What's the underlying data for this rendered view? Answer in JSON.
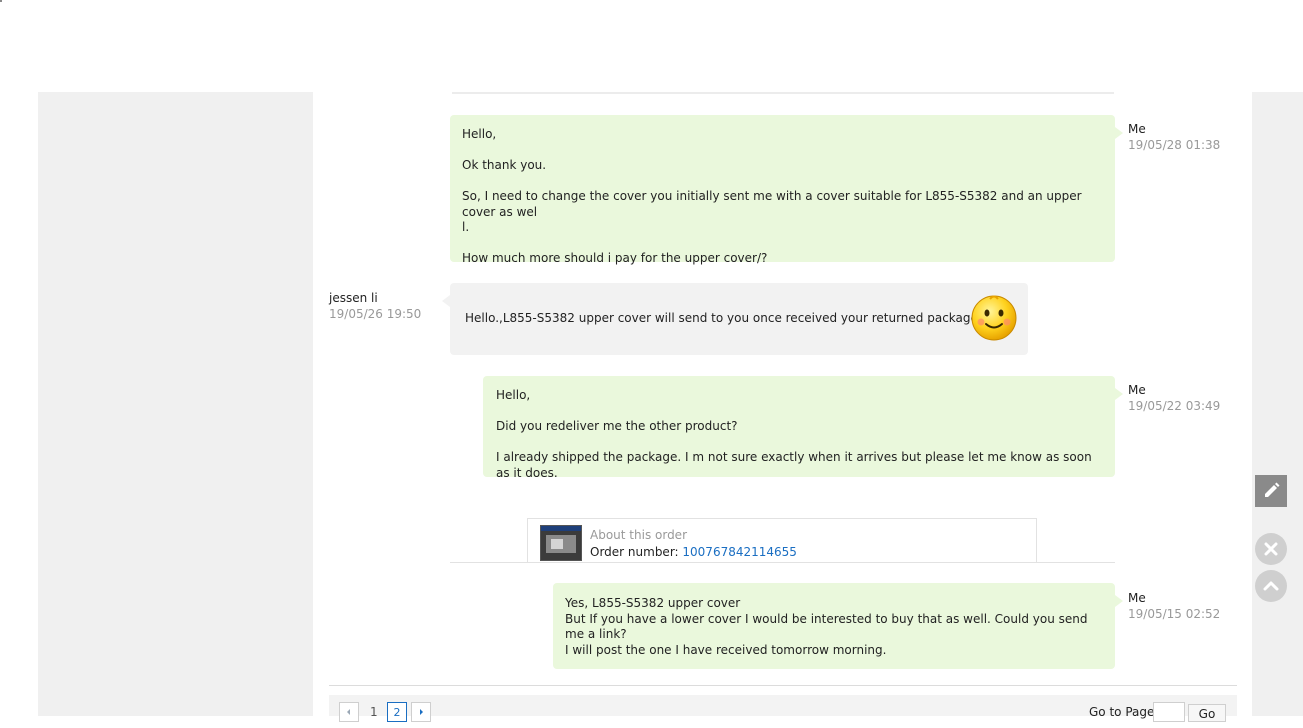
{
  "colors": {
    "me_bubble": "#eaf8dc",
    "other_bubble": "#f2f2f2",
    "link": "#1a6ec2",
    "timestamp": "#999999"
  },
  "messages": [
    {
      "sender": "Me",
      "time": "19/05/28 01:38",
      "lines": [
        "Hello,",
        "Ok thank you.",
        "So, I need to change the cover you initially sent me with a cover suitable for L855-S5382 and an upper cover as wel",
        "l.",
        "How much more should i pay for the upper cover/?"
      ]
    },
    {
      "sender": "jessen li",
      "time": "19/05/26 19:50",
      "lines": [
        "Hello.,L855-S5382 upper cover will send to you once received  your returned package okey"
      ],
      "icon": "smiley-emoticon-icon"
    },
    {
      "sender": "Me",
      "time": "19/05/22 03:49",
      "lines": [
        "Hello,",
        "Did you redeliver me the other product?",
        "I already shipped the package. I m not sure exactly when it arrives but please let me know as soon as it does."
      ]
    },
    {
      "sender": "Me",
      "time": "19/05/15 02:52",
      "lines": [
        "Yes,  L855-S5382 upper cover",
        "But If you have a lower cover I would be interested to buy that as well. Could you send me a link?",
        "I will post the one I have received tomorrow morning."
      ]
    }
  ],
  "order_card": {
    "label": "About this order",
    "number_label": "Order number: ",
    "number": "100767842114655",
    "icon": "product-thumbnail-image"
  },
  "pagination": {
    "prev_icon": "chevron-left-icon",
    "next_icon": "chevron-right-icon",
    "pages": [
      "1",
      "2"
    ],
    "current_page": "2",
    "goto_label": "Go to Page",
    "goto_value": "",
    "go_button": "Go"
  },
  "side_tools": {
    "edit_icon": "pencil-icon",
    "close_icon": "close-icon",
    "top_icon": "chevron-up-icon"
  }
}
